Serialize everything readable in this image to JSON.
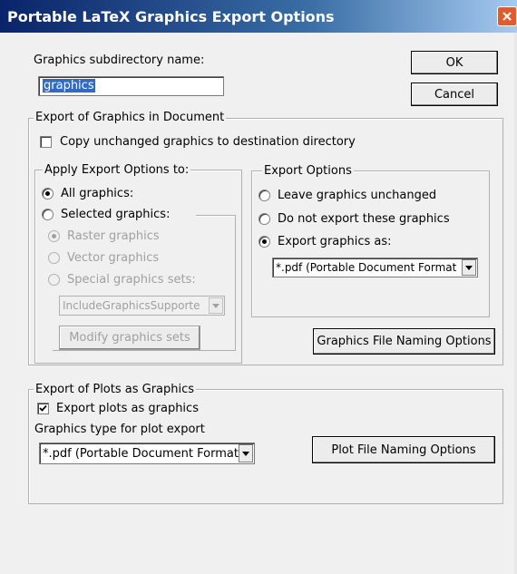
{
  "window": {
    "title": "Portable LaTeX Graphics Export Options"
  },
  "top": {
    "subdir_label": "Graphics subdirectory name:",
    "subdir_value": "graphics",
    "ok_label": "OK",
    "cancel_label": "Cancel"
  },
  "export_graphics": {
    "group_title": "Export of Graphics in Document",
    "copy_unchanged_label": "Copy unchanged graphics to destination directory",
    "copy_unchanged_checked": false,
    "apply_to": {
      "group_title": "Apply Export Options to:",
      "all_label": "All graphics:",
      "selected_label": "Selected graphics:",
      "raster_label": "Raster graphics",
      "vector_label": "Vector graphics",
      "special_label": "Special graphics sets:",
      "special_combo_value": "IncludeGraphicsSupporte",
      "modify_label": "Modify graphics sets",
      "selected": "All graphics"
    },
    "options": {
      "group_title": "Export Options",
      "leave_label": "Leave graphics unchanged",
      "donot_label": "Do not export these graphics",
      "exportas_label": "Export graphics as:",
      "format_value": "*.pdf (Portable Document Format",
      "selected": "Export graphics as"
    },
    "naming_label": "Graphics File Naming Options"
  },
  "export_plots": {
    "group_title": "Export of Plots as Graphics",
    "export_plots_label": "Export plots as graphics",
    "export_plots_checked": true,
    "type_label": "Graphics type for plot export",
    "type_value": "*.pdf (Portable Document Format)",
    "naming_label": "Plot File Naming Options"
  },
  "icons": {
    "close": "close-icon",
    "combo_arrow": "chevron-down-icon"
  },
  "colors": {
    "title_bar": "#0a246a",
    "close_button": "#e35a2c",
    "selection": "#316ac5",
    "disabled_text": "#a0a0a0"
  }
}
